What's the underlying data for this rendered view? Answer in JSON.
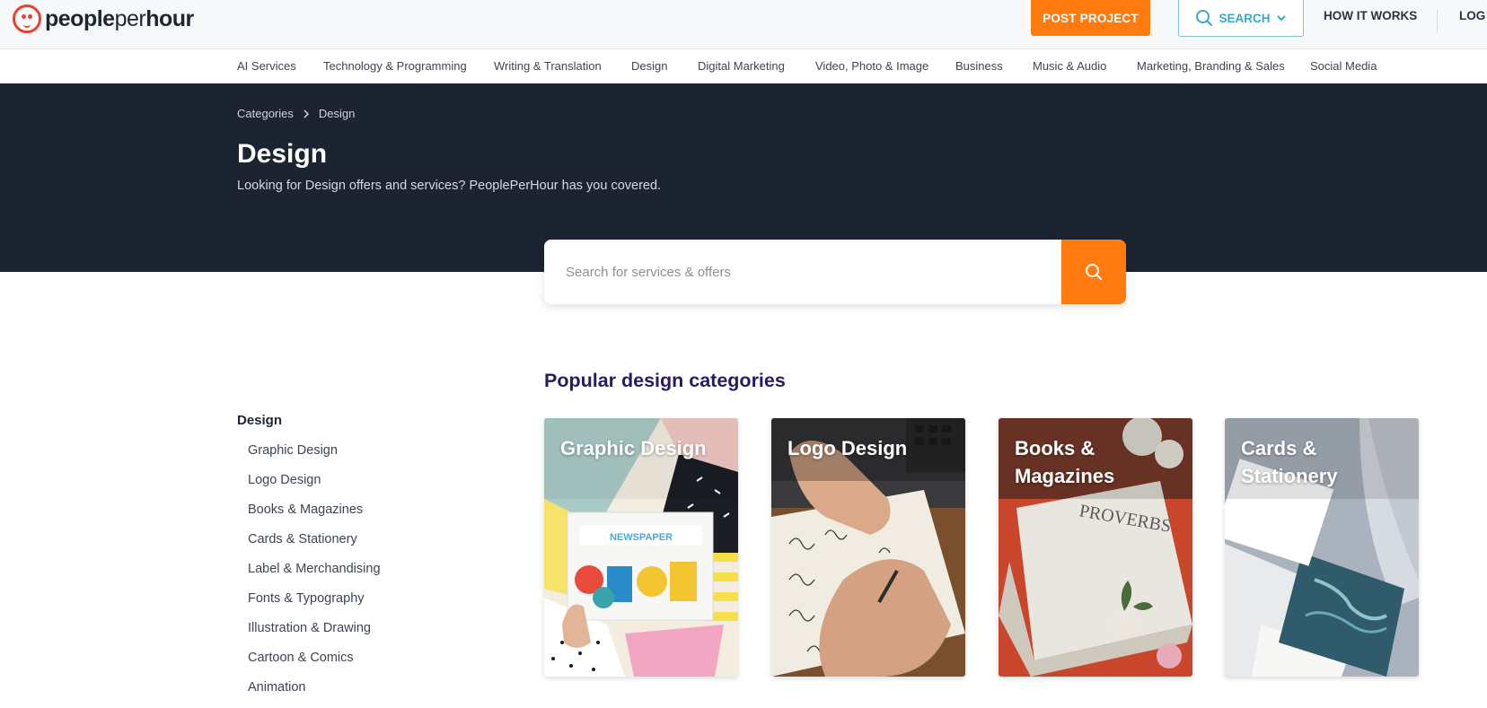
{
  "header": {
    "logo_bold": "people",
    "logo_light": "per",
    "logo_bold2": "hour",
    "post_project": "POST PROJECT",
    "search": "SEARCH",
    "how_it_works": "HOW IT WORKS",
    "login_partial": "LOG"
  },
  "category_nav": [
    "AI Services",
    "Technology & Programming",
    "Writing & Translation",
    "Design",
    "Digital Marketing",
    "Video, Photo & Image",
    "Business",
    "Music & Audio",
    "Marketing, Branding & Sales",
    "Social Media"
  ],
  "hero": {
    "breadcrumb": [
      "Categories",
      "Design"
    ],
    "title": "Design",
    "subtitle": "Looking for Design offers and services? PeoplePerHour has you covered."
  },
  "search": {
    "placeholder": "Search for services & offers"
  },
  "sidebar": {
    "title": "Design",
    "items": [
      "Graphic Design",
      "Logo Design",
      "Books & Magazines",
      "Cards & Stationery",
      "Label & Merchandising",
      "Fonts & Typography",
      "Illustration & Drawing",
      "Cartoon & Comics",
      "Animation"
    ]
  },
  "popular": {
    "title": "Popular design categories",
    "cards": [
      {
        "label": "Graphic Design",
        "image_text": "NEWSPAPER"
      },
      {
        "label": "Logo Design"
      },
      {
        "label": "Books & Magazines",
        "image_text": "PROVERBS"
      },
      {
        "label": "Cards & Stationery"
      }
    ]
  },
  "colors": {
    "accent": "#ff7b0f",
    "hero_bg": "#1c2331",
    "search_accent": "#3ba8c3",
    "heading_purple": "#2a1a5e"
  }
}
